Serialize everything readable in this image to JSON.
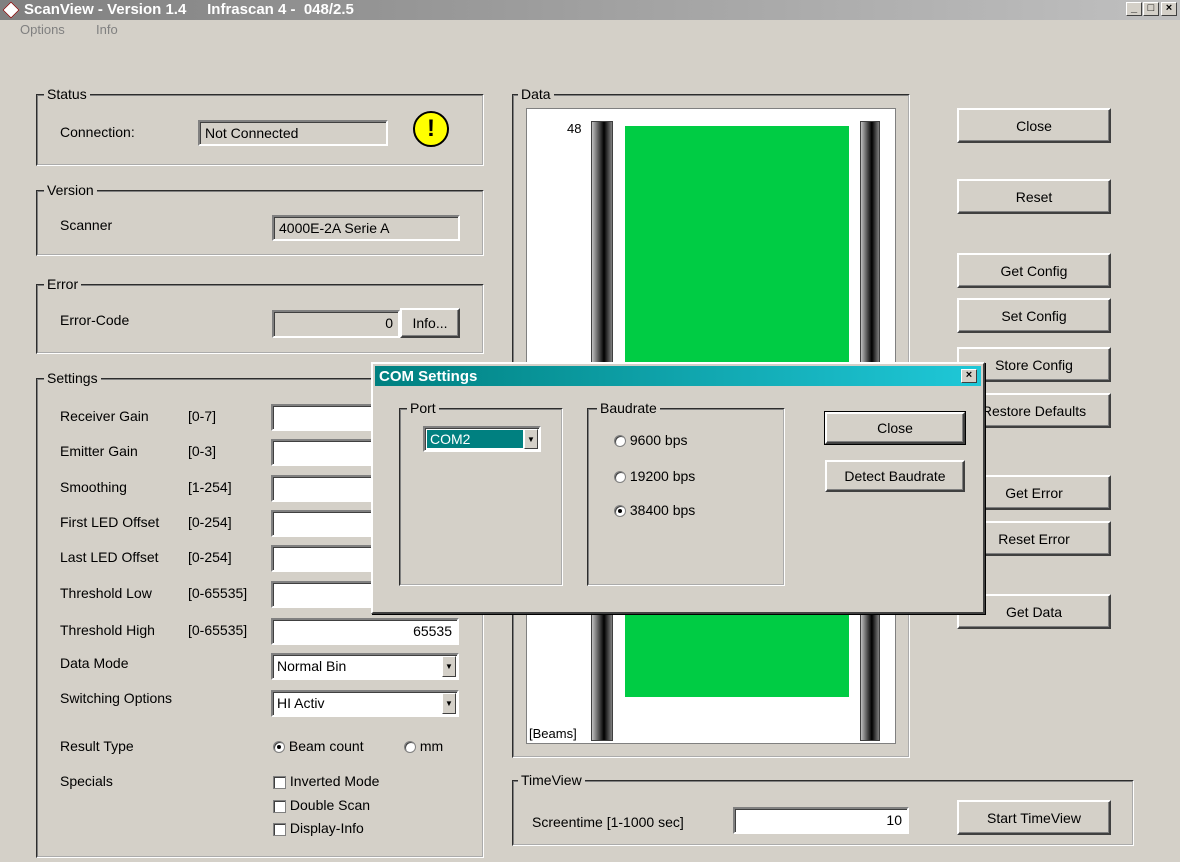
{
  "window": {
    "title": "ScanView - Version 1.4     Infrascan 4 -  048/2.5",
    "minimize_glyph": "_",
    "maximize_glyph": "□",
    "close_glyph": "×"
  },
  "menu": [
    "Options",
    "Info"
  ],
  "status": {
    "label": "Status",
    "connection_label": "Connection:",
    "connection_value": "Not Connected",
    "warning_glyph": "!"
  },
  "version": {
    "label": "Version",
    "scanner_label": "Scanner",
    "scanner_value": "4000E-2A Serie A"
  },
  "error": {
    "label": "Error",
    "code_label": "Error-Code",
    "code_value": "0",
    "info_button": "Info..."
  },
  "settings": {
    "label": "Settings",
    "rows": [
      {
        "name": "Receiver Gain",
        "range": "[0-7]",
        "value": ""
      },
      {
        "name": "Emitter Gain",
        "range": "[0-3]",
        "value": ""
      },
      {
        "name": "Smoothing",
        "range": "[1-254]",
        "value": ""
      },
      {
        "name": "First LED Offset",
        "range": "[0-254]",
        "value": ""
      },
      {
        "name": "Last LED Offset",
        "range": "[0-254]",
        "value": ""
      },
      {
        "name": "Threshold Low",
        "range": "[0-65535]",
        "value": ""
      },
      {
        "name": "Threshold High",
        "range": "[0-65535]",
        "value": "65535"
      }
    ],
    "data_mode_label": "Data Mode",
    "data_mode_value": "Normal Bin",
    "switching_label": "Switching Options",
    "switching_value": "HI Activ",
    "result_type_label": "Result Type",
    "result_beam": "Beam count",
    "result_mm": "mm",
    "specials_label": "Specials",
    "specials": [
      "Inverted Mode",
      "Double Scan",
      "Display-Info"
    ]
  },
  "data_panel": {
    "label": "Data",
    "top_value": "48",
    "axis_unit": "[Beams]",
    "bar_color": "#00cc44"
  },
  "buttons": {
    "close": "Close",
    "reset": "Reset",
    "get_config": "Get Config",
    "set_config": "Set Config",
    "store_config": "Store Config",
    "restore_defaults": "Restore Defaults",
    "get_error": "Get Error",
    "reset_error": "Reset Error",
    "get_data": "Get Data"
  },
  "timeview": {
    "label": "TimeView",
    "screentime_label": "Screentime [1-1000 sec]",
    "screentime_value": "10",
    "start_button": "Start TimeView"
  },
  "com_dialog": {
    "title": "COM Settings",
    "close_glyph": "×",
    "port_label": "Port",
    "port_value": "COM2",
    "baudrate_label": "Baudrate",
    "baud_options": [
      "9600 bps",
      "19200 bps",
      "38400 bps"
    ],
    "baud_selected": "38400 bps",
    "close_button": "Close",
    "detect_button": "Detect Baudrate"
  }
}
